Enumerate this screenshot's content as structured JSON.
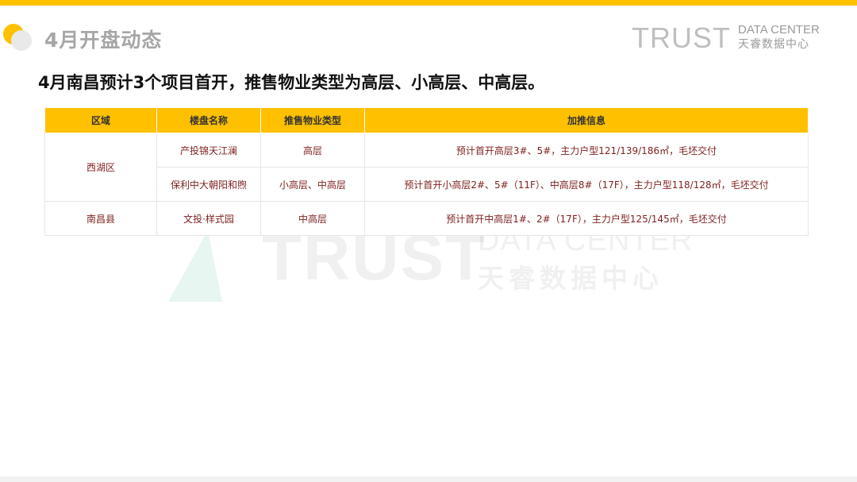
{
  "header": {
    "title": "4月开盘动态",
    "brand_big": "TRUST",
    "brand_en": "DATA CENTER",
    "brand_cn": "天睿数据中心"
  },
  "headline": "4月南昌预计3个项目首开，推售物业类型为高层、小高层、中高层。",
  "table": {
    "headers": [
      "区域",
      "楼盘名称",
      "推售物业类型",
      "加推信息"
    ],
    "groups": [
      {
        "region": "西湖区",
        "rows": [
          {
            "name": "产投锦天江澜",
            "type": "高层",
            "info": "预计首开高层3#、5#，主力户型121/139/186㎡，毛坯交付"
          },
          {
            "name": "保利中大朝阳和煦",
            "type": "小高层、中高层",
            "info": "预计首开小高层2#、5#（11F）、中高层8#（17F），主力户型118/128㎡，毛坯交付"
          }
        ]
      },
      {
        "region": "南昌县",
        "rows": [
          {
            "name": "文投·样式园",
            "type": "中高层",
            "info": "预计首开中高层1#、2#（17F），主力户型125/145㎡，毛坯交付"
          }
        ]
      }
    ]
  },
  "watermark": {
    "big": "TRUST",
    "en": "DATA CENTER",
    "cn": "天睿数据中心"
  },
  "colors": {
    "accent": "#FFC000",
    "cell_text": "#7f1f1f",
    "title_gray": "#a6a6a6"
  }
}
